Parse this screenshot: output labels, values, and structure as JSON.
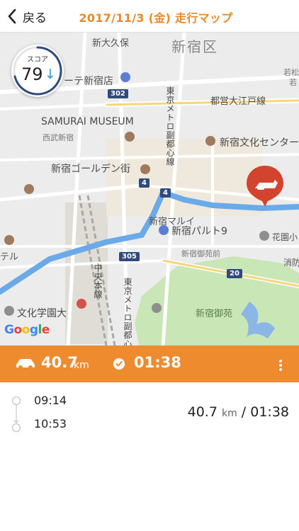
{
  "header": {
    "back_label": "戻る",
    "title": "2017/11/3 (金) 走行マップ"
  },
  "map": {
    "score_label": "スコア",
    "score_value": "79",
    "score_trend": "↓",
    "route_color": "#6aaae8",
    "event_color": "#d3442e",
    "labels": {
      "district": "新宿区",
      "shin_okubo": "新大久保",
      "shinjuku_store": "ーテ新宿店",
      "samurai": "SAMURAI MUSEUM",
      "seibu": "西武新宿",
      "golden_gai": "新宿ゴールデン街",
      "oedo": "都営大江戸線",
      "bunka_center": "新宿文化センター",
      "fukutoshin": "東京メトロ副都心線",
      "fukutoshin2": "東京メトロ副都心線",
      "marui": "新宿マルイ",
      "wakamatsu": "若松",
      "wakamatsu_short": "若",
      "shinjuku_park": "新宿パルト9",
      "hanazono": "花園小",
      "gyoen_mae": "新宿御苑前",
      "shobo": "消防",
      "chuo": "中央本線",
      "gyoen": "新宿御苑",
      "bunka_gakuen": "文化学園大",
      "hotel": "テル",
      "google": "Google"
    },
    "shields": [
      "302",
      "4",
      "4",
      "305",
      "20"
    ]
  },
  "trip_bar": {
    "distance": "40.7",
    "distance_unit": "km",
    "duration": "01:38"
  },
  "trip": {
    "start_time": "09:14",
    "end_time": "10:53",
    "summary_distance": "40.7",
    "summary_unit": "km",
    "summary_sep": "/",
    "summary_duration": "01:38"
  }
}
